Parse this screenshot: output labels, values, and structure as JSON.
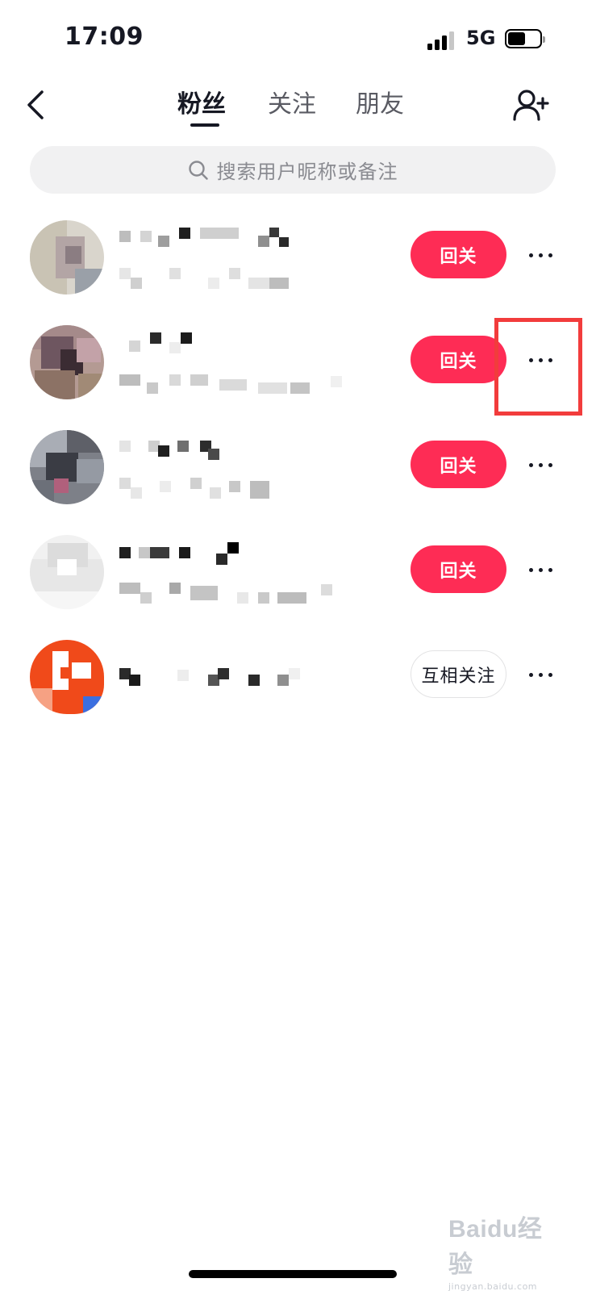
{
  "status_bar": {
    "time": "17:09",
    "network": "5G"
  },
  "nav": {
    "tabs": [
      {
        "label": "粉丝",
        "active": true
      },
      {
        "label": "关注",
        "active": false
      },
      {
        "label": "朋友",
        "active": false
      }
    ],
    "back_icon": "chevron-left-icon",
    "add_friend_icon": "add-user-icon"
  },
  "search": {
    "placeholder": "搜索用户昵称或备注",
    "icon": "search-icon"
  },
  "followers": [
    {
      "button_label": "回关",
      "button_style": "primary"
    },
    {
      "button_label": "回关",
      "button_style": "primary"
    },
    {
      "button_label": "回关",
      "button_style": "primary"
    },
    {
      "button_label": "回关",
      "button_style": "primary"
    },
    {
      "button_label": "互相关注",
      "button_style": "secondary"
    }
  ],
  "colors": {
    "accent": "#fe2c55",
    "highlight": "#f23c3c",
    "text": "#161823"
  },
  "watermark": {
    "main": "Baidu经验",
    "sub": "jingyan.baidu.com"
  }
}
